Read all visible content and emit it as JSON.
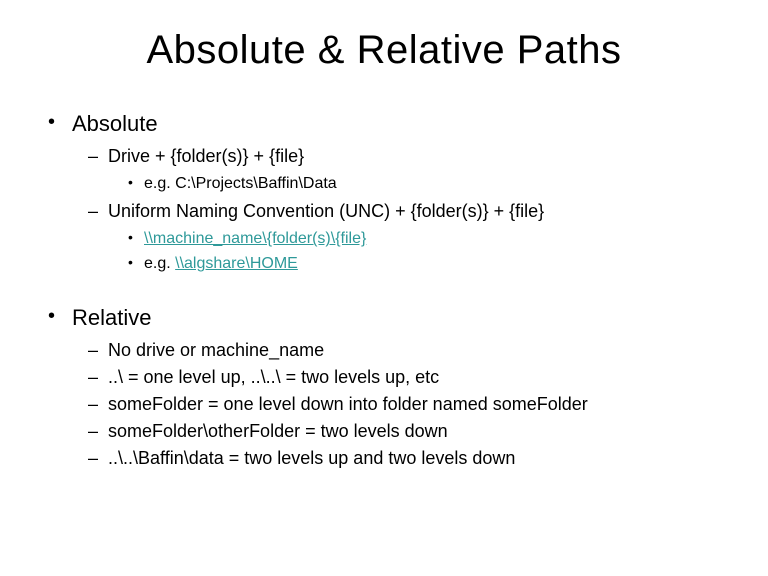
{
  "title": "Absolute &  Relative Paths",
  "sections": [
    {
      "heading": "Absolute",
      "items": [
        {
          "text": "Drive + {folder(s)} + {file}",
          "sub": [
            {
              "text": "e.g. C:\\Projects\\Baffin\\Data",
              "link": false
            }
          ]
        },
        {
          "text": "Uniform Naming Convention (UNC) + {folder(s)} + {file}",
          "sub": [
            {
              "text": "\\\\machine_name\\{folder(s)\\{file}",
              "link": true
            },
            {
              "prefix": "e.g. ",
              "text": "\\\\algshare\\HOME",
              "link": true
            }
          ]
        }
      ]
    },
    {
      "heading": "Relative",
      "items": [
        {
          "text": "No drive or machine_name"
        },
        {
          "text": "..\\ = one level up, ..\\..\\ = two levels up, etc"
        },
        {
          "text": "someFolder = one level down into folder named someFolder"
        },
        {
          "text": "someFolder\\otherFolder = two levels down"
        },
        {
          "text": "..\\..\\Baffin\\data = two levels up and two levels down"
        }
      ]
    }
  ]
}
